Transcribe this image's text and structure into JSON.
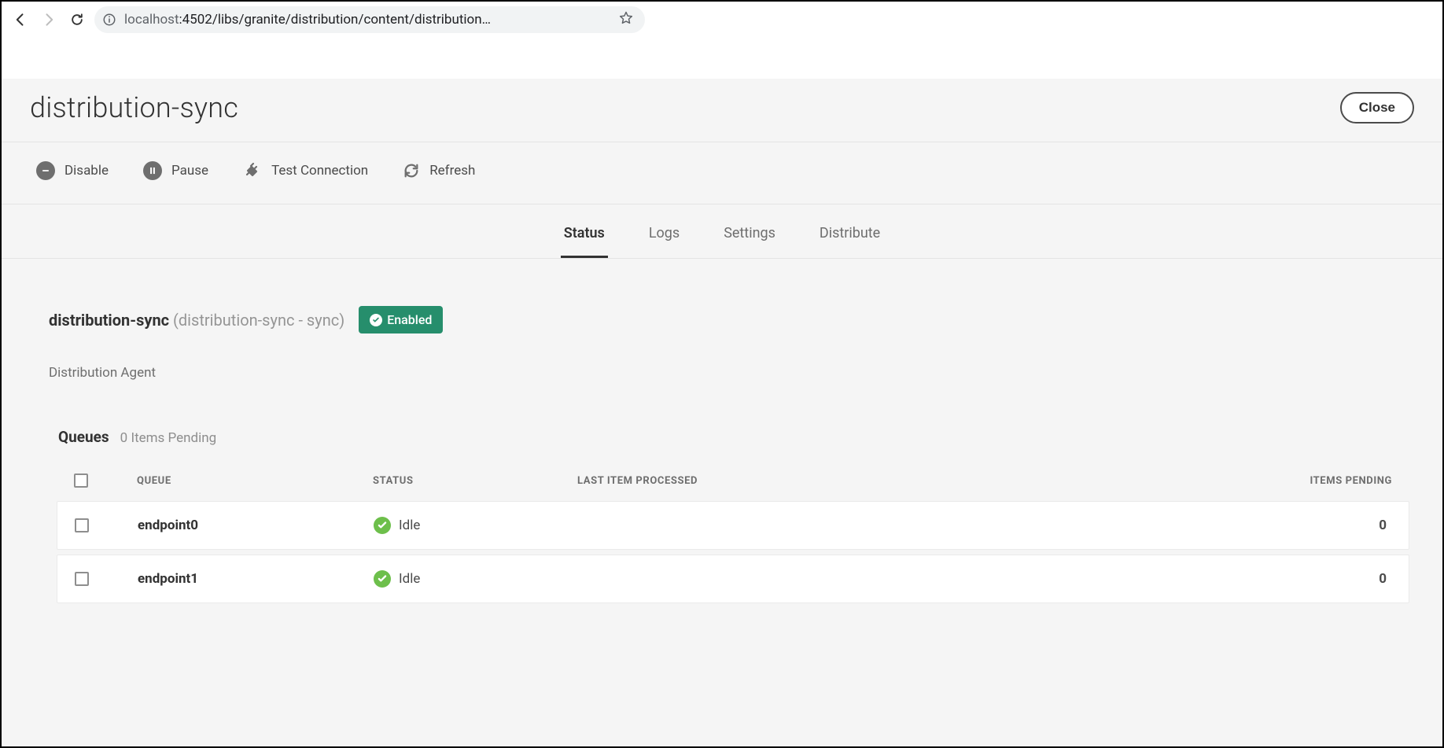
{
  "browser": {
    "url_host": "localhost",
    "url_rest": ":4502/libs/granite/distribution/content/distribution…"
  },
  "header": {
    "title": "distribution-sync",
    "close": "Close"
  },
  "toolbar": {
    "disable": "Disable",
    "pause": "Pause",
    "test": "Test Connection",
    "refresh": "Refresh"
  },
  "tabs": {
    "status": "Status",
    "logs": "Logs",
    "settings": "Settings",
    "distribute": "Distribute",
    "active": "status"
  },
  "agent": {
    "name": "distribution-sync",
    "sub": "(distribution-sync - sync)",
    "badge": "Enabled",
    "type_label": "Distribution Agent"
  },
  "queues": {
    "title": "Queues",
    "pending_summary": "0 Items Pending",
    "columns": {
      "queue": "QUEUE",
      "status": "STATUS",
      "last": "LAST ITEM PROCESSED",
      "pending": "ITEMS PENDING"
    },
    "rows": [
      {
        "name": "endpoint0",
        "status": "Idle",
        "last": "",
        "pending": "0"
      },
      {
        "name": "endpoint1",
        "status": "Idle",
        "last": "",
        "pending": "0"
      }
    ]
  }
}
